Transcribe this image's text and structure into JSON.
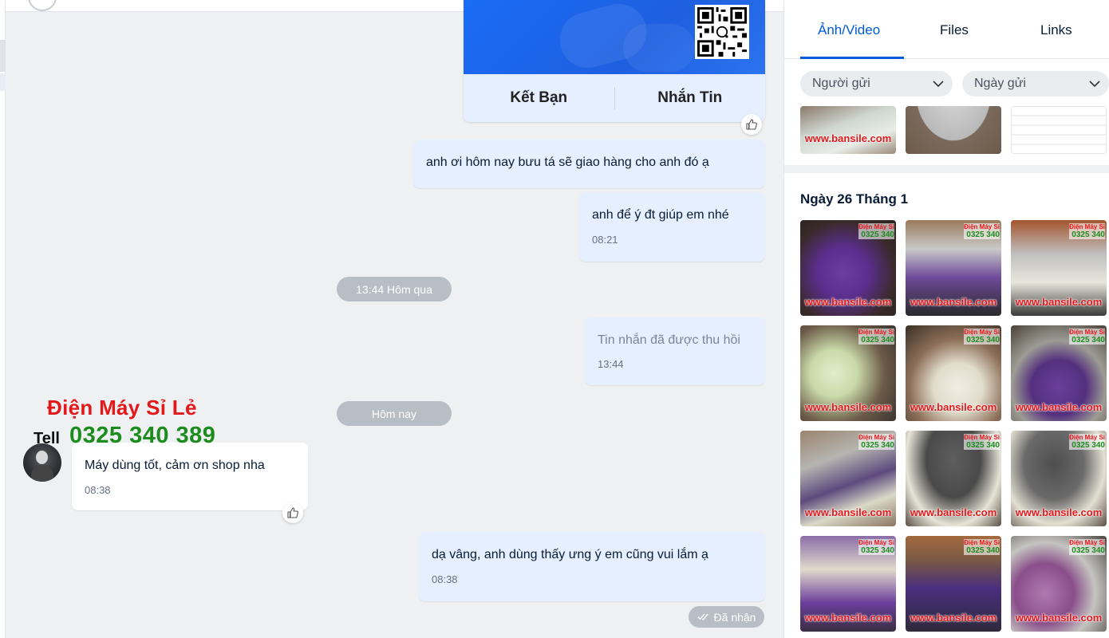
{
  "contact_card": {
    "add_friend_label": "Kết Bạn",
    "message_label": "Nhắn Tin"
  },
  "messages": [
    {
      "id": "m1",
      "direction": "out",
      "text": "anh ơi hôm nay bưu tá sẽ giao hàng cho anh đó ạ",
      "time": ""
    },
    {
      "id": "m2",
      "direction": "out",
      "text": "anh để ý đt giúp em nhé",
      "time": "08:21"
    },
    {
      "id": "m3",
      "direction": "out",
      "text": "Tin nhắn đã được thu hồi",
      "time": "13:44",
      "recalled": true
    },
    {
      "id": "m4",
      "direction": "in",
      "text": "Máy dùng tốt, cảm ơn shop nha",
      "time": "08:38"
    },
    {
      "id": "m5",
      "direction": "out",
      "text": "dạ vâng, anh dùng thấy ưng ý em cũng vui lắm ạ",
      "time": "08:38"
    }
  ],
  "separators": {
    "yesterday": "13:44 Hôm qua",
    "today": "Hôm nay"
  },
  "watermark": {
    "name": "Điện Máy Sỉ Lẻ",
    "tell": "Tell",
    "phone": "0325 340 389"
  },
  "status": {
    "received": "Đã nhận"
  },
  "panel": {
    "tabs": [
      {
        "label": "Ảnh/Video",
        "active": true
      },
      {
        "label": "Files",
        "active": false
      },
      {
        "label": "Links",
        "active": false
      }
    ],
    "filters": {
      "sender": "Người gửi",
      "date": "Ngày gửi"
    },
    "date_group": "Ngày 26 Tháng 1",
    "thumb_watermark": "www.bansile.com",
    "thumb_tag_name": "Điện Máy Sỉ",
    "thumb_tag_phone": "0325 340"
  },
  "colors": {
    "accent": "#005ae0",
    "bubble_me": "#e5efff",
    "chat_bg": "#eef0f1",
    "watermark_red": "#e3181b",
    "watermark_green": "#1c8c1e"
  }
}
